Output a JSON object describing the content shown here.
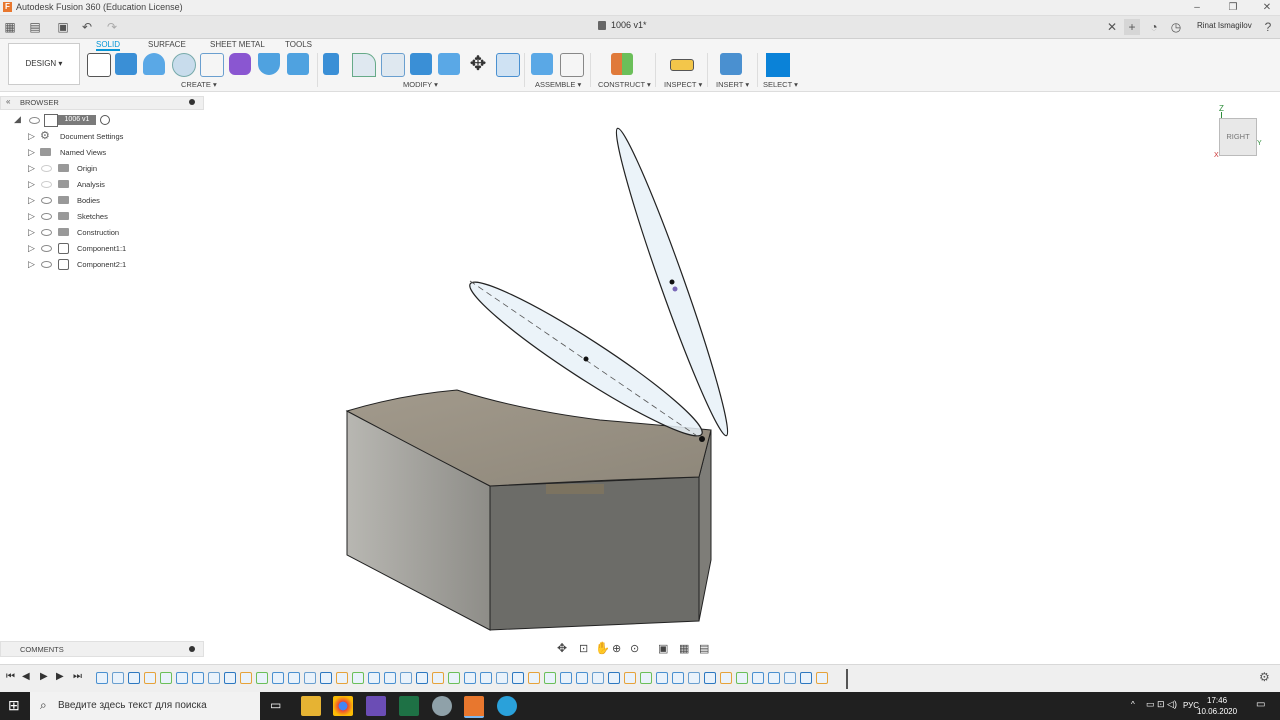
{
  "window": {
    "title": "Autodesk Fusion 360 (Education License)",
    "app_icon": "F"
  },
  "tabbar": {
    "document_tab": "1006 v1*",
    "user": "Rinat Ismagilov"
  },
  "toolbar": {
    "workspace": "DESIGN ▾",
    "modes": [
      "SOLID",
      "SURFACE",
      "SHEET METAL",
      "TOOLS"
    ],
    "groups": {
      "create": "CREATE ▾",
      "modify": "MODIFY ▾",
      "assemble": "ASSEMBLE ▾",
      "construct": "CONSTRUCT ▾",
      "inspect": "INSPECT ▾",
      "insert": "INSERT ▾",
      "select": "SELECT ▾"
    }
  },
  "browser": {
    "title": "BROWSER",
    "root": "1006 v1",
    "items": [
      {
        "label": "Document Settings"
      },
      {
        "label": "Named Views"
      },
      {
        "label": "Origin"
      },
      {
        "label": "Analysis"
      },
      {
        "label": "Bodies"
      },
      {
        "label": "Sketches"
      },
      {
        "label": "Construction"
      },
      {
        "label": "Component1:1"
      },
      {
        "label": "Component2:1"
      }
    ]
  },
  "comments": {
    "title": "COMMENTS"
  },
  "viewcube": {
    "face": "RIGHT",
    "axis_z": "Z",
    "axis_x": "X",
    "axis_y": "Y"
  },
  "taskbar": {
    "search_placeholder": "Введите здесь текст для поиска",
    "lang": "РУС",
    "time": "17:46",
    "date": "10.06.2020"
  },
  "colors": {
    "accent": "#0696d7",
    "body_top": "#a09888",
    "body_front": "#6a6a66",
    "body_left": "#9e9d98"
  }
}
